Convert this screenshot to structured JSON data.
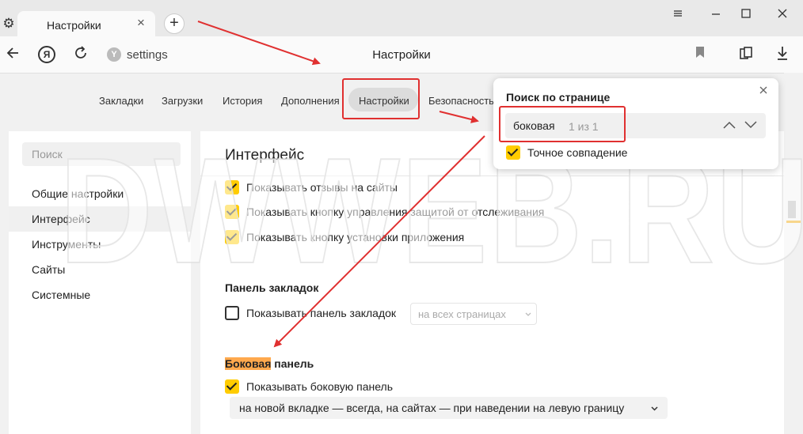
{
  "window": {
    "tab_title": "Настройки",
    "url": "settings",
    "page_title": "Настройки",
    "icons": [
      "gear-icon",
      "close-icon",
      "plus-icon",
      "minimize-icon",
      "restore-icon",
      "close-icon",
      "back-arrow-icon",
      "yandex-logo-icon",
      "reload-icon",
      "site-icon",
      "bookmark-icon",
      "collections-icon",
      "download-icon"
    ]
  },
  "settings_nav": {
    "items": [
      {
        "label": "Закладки"
      },
      {
        "label": "Загрузки"
      },
      {
        "label": "История"
      },
      {
        "label": "Дополнения"
      },
      {
        "label": "Настройки",
        "active": true
      },
      {
        "label": "Безопасность"
      }
    ]
  },
  "sidebar": {
    "search_placeholder": "Поиск",
    "items": [
      {
        "label": "Общие настройки"
      },
      {
        "label": "Интерфейс",
        "active": true
      },
      {
        "label": "Инструменты"
      },
      {
        "label": "Сайты"
      },
      {
        "label": "Системные"
      }
    ]
  },
  "main": {
    "section_title": "Интерфейс",
    "options": [
      {
        "label": "Показывать отзывы на сайты",
        "checked": true
      },
      {
        "label": "Показывать кнопку управления защитой от отслеживания",
        "checked": true
      },
      {
        "label": "Показывать кнопку установки приложения",
        "checked": true
      }
    ],
    "bookmarks_panel": {
      "title": "Панель закладок",
      "option_label": "Показывать панель закладок",
      "checked": false,
      "select_value": "на всех страницах"
    },
    "side_panel": {
      "title_highlight": "Боковая",
      "title_rest": " панель",
      "option_label": "Показывать боковую панель",
      "checked": true,
      "select_value": "на новой вкладке — всегда, на сайтах — при наведении на левую границу"
    }
  },
  "find_popup": {
    "title": "Поиск по странице",
    "query": "боковая",
    "count": "1 из 1",
    "exact_match_label": "Точное совпадение",
    "exact_match_checked": true
  },
  "watermark": "DWWEB.RU",
  "colors": {
    "accent": "#ffcc00",
    "highlight": "#ffa94d",
    "annotation": "#e03030"
  }
}
